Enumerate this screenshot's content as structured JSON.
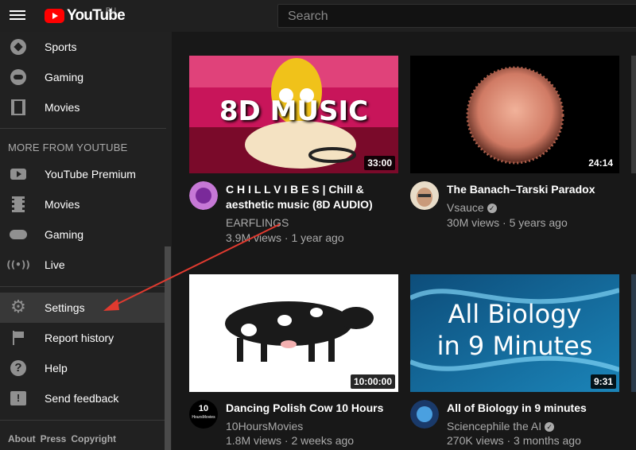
{
  "topbar": {
    "logo_text": "YouTube",
    "logo_region": "RU",
    "search_placeholder": "Search"
  },
  "sidebar": {
    "top_items": [
      {
        "label": "Sports",
        "icon": "sports-icon"
      },
      {
        "label": "Gaming",
        "icon": "gaming-icon"
      },
      {
        "label": "Movies",
        "icon": "movies-icon"
      }
    ],
    "more_title": "MORE FROM YOUTUBE",
    "more_items": [
      {
        "label": "YouTube Premium",
        "icon": "youtube-premium-icon"
      },
      {
        "label": "Movies",
        "icon": "movies-icon"
      },
      {
        "label": "Gaming",
        "icon": "gaming-icon"
      },
      {
        "label": "Live",
        "icon": "live-icon"
      }
    ],
    "settings_items": [
      {
        "label": "Settings",
        "icon": "gear-icon",
        "active": true
      },
      {
        "label": "Report history",
        "icon": "flag-icon"
      },
      {
        "label": "Help",
        "icon": "help-icon"
      },
      {
        "label": "Send feedback",
        "icon": "feedback-icon"
      }
    ],
    "footer_links": [
      "About",
      "Press",
      "Copyright"
    ]
  },
  "videos": [
    {
      "thumb_text": "8D MUSIC",
      "duration": "33:00",
      "title_line1": "C H I L L V I B E S | Chill &",
      "title_line2": "aesthetic music (8D AUDIO)",
      "channel": "EARFLINGS",
      "meta": "3.9M views · 1 year ago",
      "verified": false
    },
    {
      "duration": "24:14",
      "title_line1": "The Banach–Tarski Paradox",
      "channel": "Vsauce",
      "meta": "30M views · 5 years ago",
      "verified": true
    },
    {
      "duration": "10:00:00",
      "title_line1": "Dancing Polish Cow 10 Hours",
      "channel": "10HoursMovies",
      "meta": "1.8M views · 2 weeks ago",
      "verified": false,
      "avatar_text_1": "10",
      "avatar_text_2": "HoursMovies"
    },
    {
      "thumb_text_1": "All Biology",
      "thumb_text_2": "in 9 Minutes",
      "duration": "9:31",
      "title_line1": "All of Biology in 9 minutes",
      "channel": "Sciencephile the AI",
      "meta": "270K views · 3 months ago",
      "verified": true
    }
  ],
  "colors": {
    "brand_red": "#ff0000",
    "annotation_arrow": "#e03a2f",
    "background": "#181818",
    "sidebar": "#212121"
  }
}
